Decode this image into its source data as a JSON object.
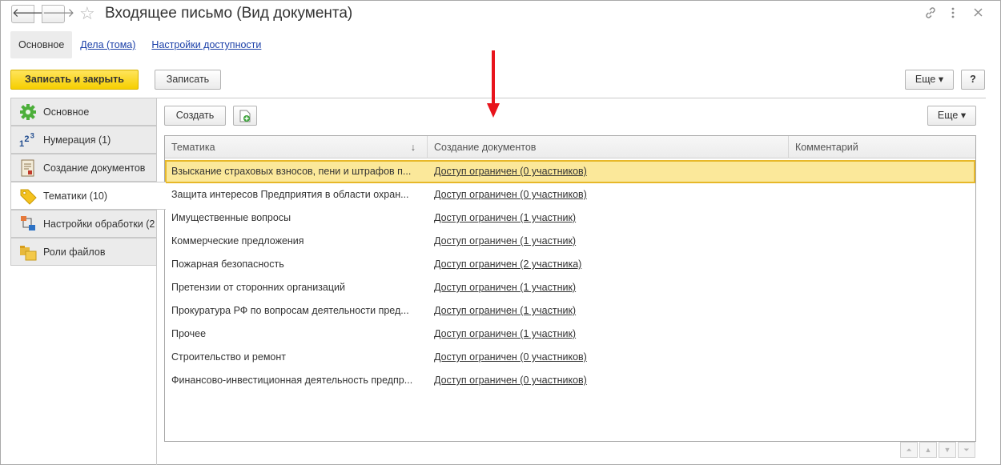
{
  "window": {
    "title": "Входящее письмо (Вид документа)",
    "back_glyph": "🡐",
    "forward_glyph": "🡒",
    "star_glyph": "☆",
    "link_glyph": "🔗",
    "more_glyph": "⋮",
    "close_glyph": "✕"
  },
  "top_tabs": [
    {
      "label": "Основное"
    },
    {
      "label": "Дела (тома)"
    },
    {
      "label": "Настройки доступности"
    }
  ],
  "toolbar": {
    "save_close_label": "Записать и закрыть",
    "save_label": "Записать",
    "more_label": "Еще ▾",
    "help_label": "?"
  },
  "side_tabs": [
    {
      "label": "Основное",
      "icon": "gear-icon"
    },
    {
      "label": "Нумерация (1)",
      "icon": "numbering-icon"
    },
    {
      "label": "Создание документов",
      "icon": "document-icon"
    },
    {
      "label": "Тематики (10)",
      "icon": "tag-icon"
    },
    {
      "label": "Настройки обработки (2",
      "icon": "workflow-icon"
    },
    {
      "label": "Роли файлов",
      "icon": "folder-icon"
    }
  ],
  "panel_toolbar": {
    "create_label": "Создать",
    "more_label": "Еще ▾"
  },
  "table": {
    "columns": [
      "Тематика",
      "Создание документов",
      "Комментарий"
    ],
    "sort_glyph": "↓",
    "rows": [
      {
        "topic": "Взыскание страховых взносов, пени и штрафов п...",
        "access": "Доступ ограничен (0 участников)",
        "comment": ""
      },
      {
        "topic": "Защита интересов Предприятия в области охран...",
        "access": "Доступ ограничен (0 участников)",
        "comment": ""
      },
      {
        "topic": "Имущественные вопросы",
        "access": "Доступ ограничен (1 участник)",
        "comment": ""
      },
      {
        "topic": "Коммерческие предложения",
        "access": "Доступ ограничен (1 участник)",
        "comment": ""
      },
      {
        "topic": "Пожарная безопасность",
        "access": "Доступ ограничен (2 участника)",
        "comment": ""
      },
      {
        "topic": "Претензии от сторонних организаций",
        "access": "Доступ ограничен (1 участник)",
        "comment": ""
      },
      {
        "topic": "Прокуратура РФ по вопросам деятельности пред...",
        "access": "Доступ ограничен (1 участник)",
        "comment": ""
      },
      {
        "topic": "Прочее",
        "access": "Доступ ограничен (1 участник)",
        "comment": ""
      },
      {
        "topic": "Строительство и ремонт",
        "access": "Доступ ограничен (0 участников)",
        "comment": ""
      },
      {
        "topic": "Финансово-инвестиционная деятельность предпр...",
        "access": "Доступ ограничен (0 участников)",
        "comment": ""
      }
    ]
  },
  "scroll": {
    "first_glyph": "⏶",
    "up_glyph": "▲",
    "down_glyph": "▼",
    "last_glyph": "⏷"
  },
  "colors": {
    "accent_yellow": "#f6cf00",
    "selected_row": "#fbe89a",
    "annotation_arrow": "#e8141c"
  }
}
